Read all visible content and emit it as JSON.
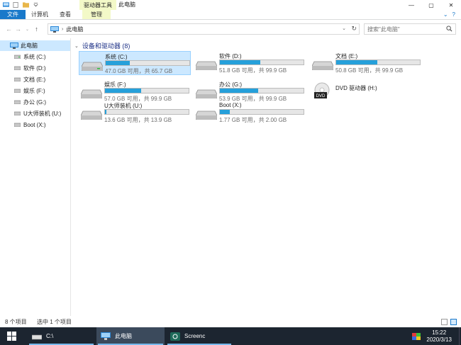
{
  "window": {
    "title": "此电脑",
    "contextual_tab_group": "驱动器工具",
    "buttons": {
      "minimize": "—",
      "maximize": "▢",
      "close": "✕"
    }
  },
  "ribbon": {
    "tabs": [
      {
        "label": "文件"
      },
      {
        "label": "计算机"
      },
      {
        "label": "查看"
      },
      {
        "label": "管理"
      }
    ],
    "right_icons": {
      "expand": "⌄",
      "help": "?"
    }
  },
  "address": {
    "crumbs": [
      "此电脑"
    ],
    "search_placeholder": "搜索\"此电脑\""
  },
  "nav": {
    "root": "此电脑",
    "items": [
      {
        "label": "系统 (C:)"
      },
      {
        "label": "软件 (D:)"
      },
      {
        "label": "文档 (E:)"
      },
      {
        "label": "娱乐 (F:)"
      },
      {
        "label": "办公 (G:)"
      },
      {
        "label": "U大师装机 (U:)"
      },
      {
        "label": "Boot (X:)"
      }
    ]
  },
  "main": {
    "group_header": "设备和驱动器 (8)",
    "drives": [
      {
        "name": "系统 (C:)",
        "size_text": "47.0 GB 可用，共 65.7 GB",
        "used_fraction": 0.285,
        "selected": true
      },
      {
        "name": "软件 (D:)",
        "size_text": "51.8 GB 可用，共 99.9 GB",
        "used_fraction": 0.48
      },
      {
        "name": "文档 (E:)",
        "size_text": "50.8 GB 可用，共 99.9 GB",
        "used_fraction": 0.49
      },
      {
        "name": "娱乐 (F:)",
        "size_text": "57.0 GB 可用，共 99.9 GB",
        "used_fraction": 0.43
      },
      {
        "name": "办公 (G:)",
        "size_text": "53.9 GB 可用，共 99.9 GB",
        "used_fraction": 0.46
      },
      {
        "name": "U大师装机 (U:)",
        "size_text": "13.6 GB 可用，共 13.9 GB",
        "used_fraction": 0.02
      },
      {
        "name": "Boot (X:)",
        "size_text": "1.77 GB 可用，共 2.00 GB",
        "used_fraction": 0.115
      }
    ],
    "dvd": {
      "name": "DVD 驱动器 (H:)",
      "badge": "DVD"
    }
  },
  "status": {
    "item_count": "8 个项目",
    "selection": "选中 1 个项目"
  },
  "taskbar": {
    "items": [
      {
        "label": "C:\\"
      },
      {
        "label": "此电脑"
      },
      {
        "label": "Screenc"
      }
    ],
    "time": "15:22",
    "date": "2020/3/13"
  },
  "colors": {
    "accent": "#1979ca",
    "bar_fill": "#26a0da",
    "selection": "#cce8ff",
    "taskbar": "#1c2530",
    "contextual_tab": "#f3f9c8"
  }
}
